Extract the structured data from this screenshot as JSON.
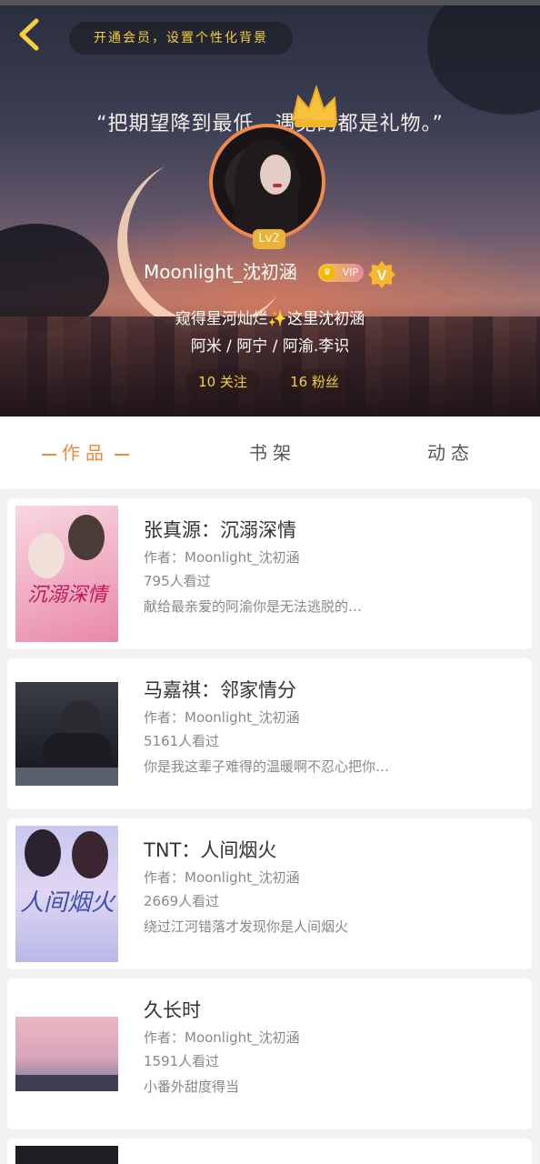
{
  "header": {
    "back_icon": "chevron-left-icon",
    "vip_banner": "开通会员，设置个性化背景",
    "quote": "“把期望降到最低，遇见的都是礼物。”",
    "level": "Lv2",
    "username": "Moonlight_沈初涵",
    "vip_badge": "VIP",
    "v_badge": "V",
    "bio_line1": "窥得星河灿烂✨这里沈初涵",
    "bio_line2": "阿米 / 阿宁 / 阿渝.李识",
    "following": "10 关注",
    "followers": "16 粉丝",
    "accent_color": "#f4d03f"
  },
  "tabs": [
    {
      "label": "作品",
      "active": true
    },
    {
      "label": "书架",
      "active": false
    },
    {
      "label": "动态",
      "active": false
    }
  ],
  "works": [
    {
      "title": "张真源：沉溺深情",
      "author": "作者：Moonlight_沈初涵",
      "views": "795人看过",
      "desc": "献给最亲爱的阿渝你是无法逃脱的…",
      "cover_text": "沉溺深情"
    },
    {
      "title": "马嘉祺：邻家情分",
      "author": "作者：Moonlight_沈初涵",
      "views": "5161人看过",
      "desc": "你是我这辈子难得的温暖啊不忍心把你…",
      "cover_text": ""
    },
    {
      "title": "TNT：人间烟火",
      "author": "作者：Moonlight_沈初涵",
      "views": "2669人看过",
      "desc": "绕过江河错落才发现你是人间烟火",
      "cover_text": "人间烟火"
    },
    {
      "title": "久长时",
      "author": "作者：Moonlight_沈初涵",
      "views": "1591人看过",
      "desc": "小番外甜度得当",
      "cover_text": ""
    }
  ]
}
